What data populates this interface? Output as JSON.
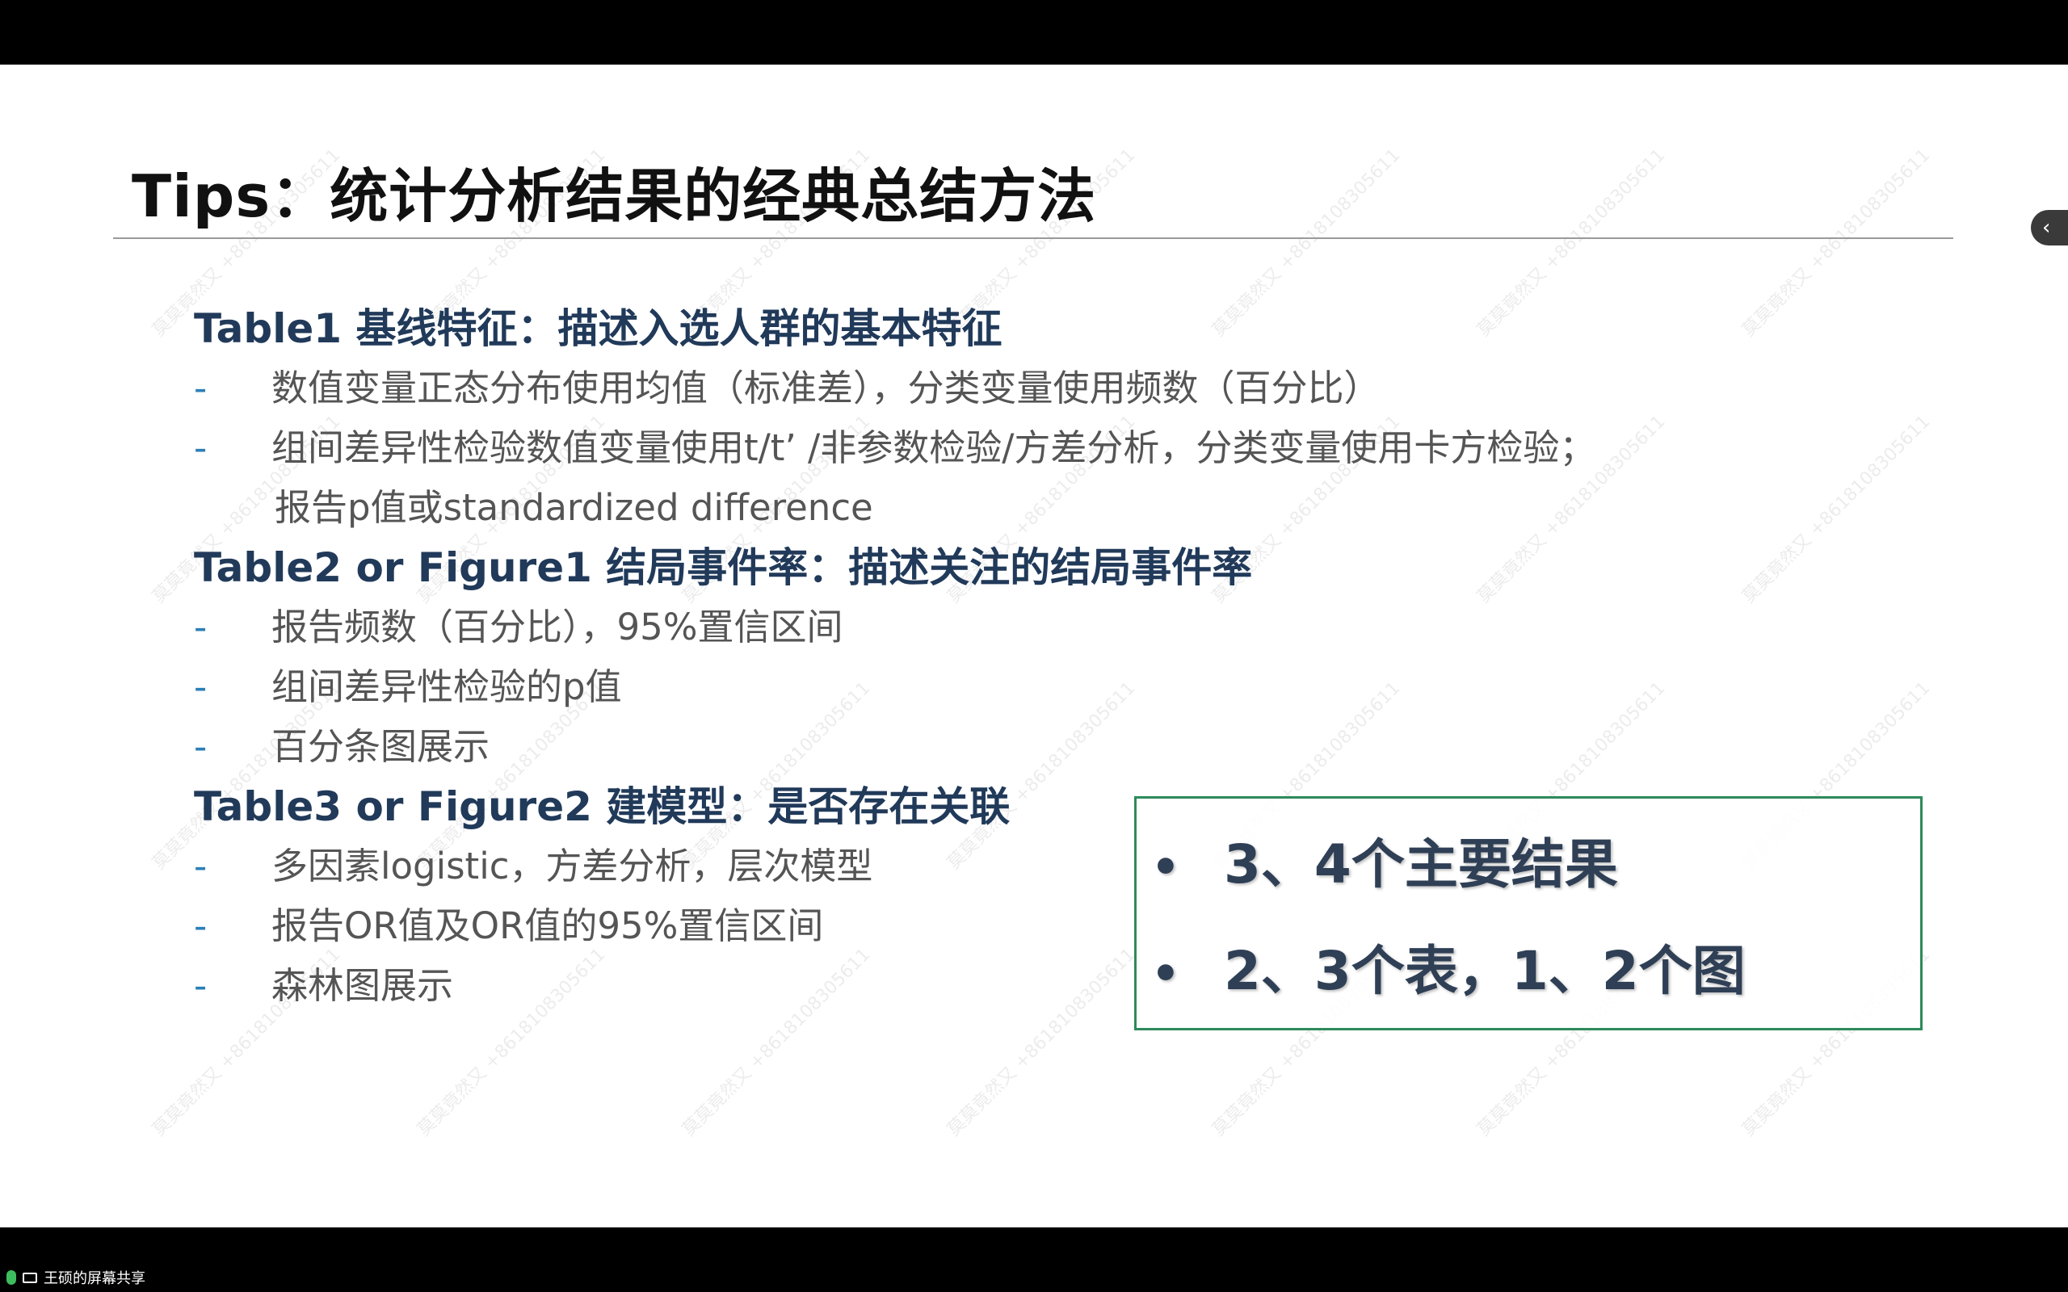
{
  "slide": {
    "title": "Tips：统计分析结果的经典总结方法",
    "sections": [
      {
        "heading": "Table1 基线特征：描述入选人群的基本特征",
        "bullets": [
          "数值变量正态分布使用均值（标准差），分类变量使用频数（百分比）",
          "组间差异性检验数值变量使用t/t’ /非参数检验/方差分析，分类变量使用卡方检验；"
        ],
        "continuation": "报告p值或standardized difference"
      },
      {
        "heading": "Table2 or Figure1 结局事件率：描述关注的结局事件率",
        "bullets": [
          "报告频数（百分比），95%置信区间",
          "组间差异性检验的p值",
          "百分条图展示"
        ]
      },
      {
        "heading": "Table3 or Figure2 建模型：是否存在关联",
        "bullets": [
          "多因素logistic，方差分析，层次模型",
          "报告OR值及OR值的95%置信区间",
          "森林图展示"
        ]
      }
    ],
    "bullet_marker": "-",
    "callout": {
      "bullet_marker": "•",
      "items": [
        "3、4个主要结果",
        "2、3个表，1、2个图"
      ]
    },
    "watermark": "莫莫竟然又 +8618108305611"
  },
  "overlay": {
    "collapse_icon": "chevron-left-icon",
    "collapse_glyph": "‹"
  },
  "taskbar": {
    "share_label": "王硕的屏幕共享",
    "icons": [
      "microphone-icon",
      "screen-share-icon"
    ]
  },
  "colors": {
    "heading": "#213a5a",
    "body_text": "#555555",
    "dash": "#2c7fb8",
    "callout_border": "#2e8a5a",
    "callout_text": "#2f3f55"
  }
}
